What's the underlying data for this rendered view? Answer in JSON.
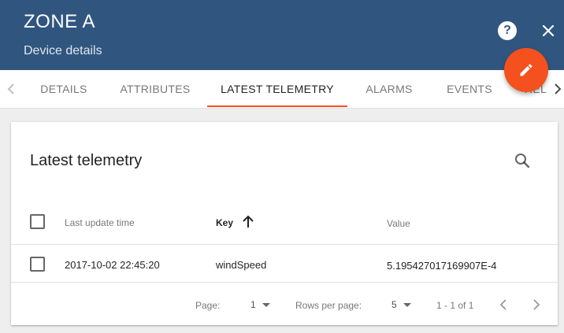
{
  "header": {
    "title": "ZONE A",
    "subtitle": "Device details",
    "help_icon": "help-icon",
    "close_icon": "close-icon",
    "background_color": "#305680"
  },
  "fab": {
    "icon": "edit-icon",
    "color": "#f4511e"
  },
  "tabs": [
    {
      "label": "DETAILS"
    },
    {
      "label": "ATTRIBUTES"
    },
    {
      "label": "LATEST TELEMETRY",
      "active": true
    },
    {
      "label": "ALARMS"
    },
    {
      "label": "EVENTS"
    },
    {
      "label": "REL"
    }
  ],
  "card": {
    "title": "Latest telemetry",
    "search_icon": "search-icon",
    "columns": [
      "Last update time",
      "Key",
      "Value"
    ],
    "sorted_column": "Key",
    "rows": [
      {
        "time": "2017-10-02 22:45:20",
        "key": "windSpeed",
        "value": "5.195427017169907E-4"
      }
    ]
  },
  "pagination": {
    "page_label": "Page:",
    "page_value": "1",
    "rows_label": "Rows per page:",
    "rows_value": "5",
    "range": "1 - 1 of 1"
  }
}
